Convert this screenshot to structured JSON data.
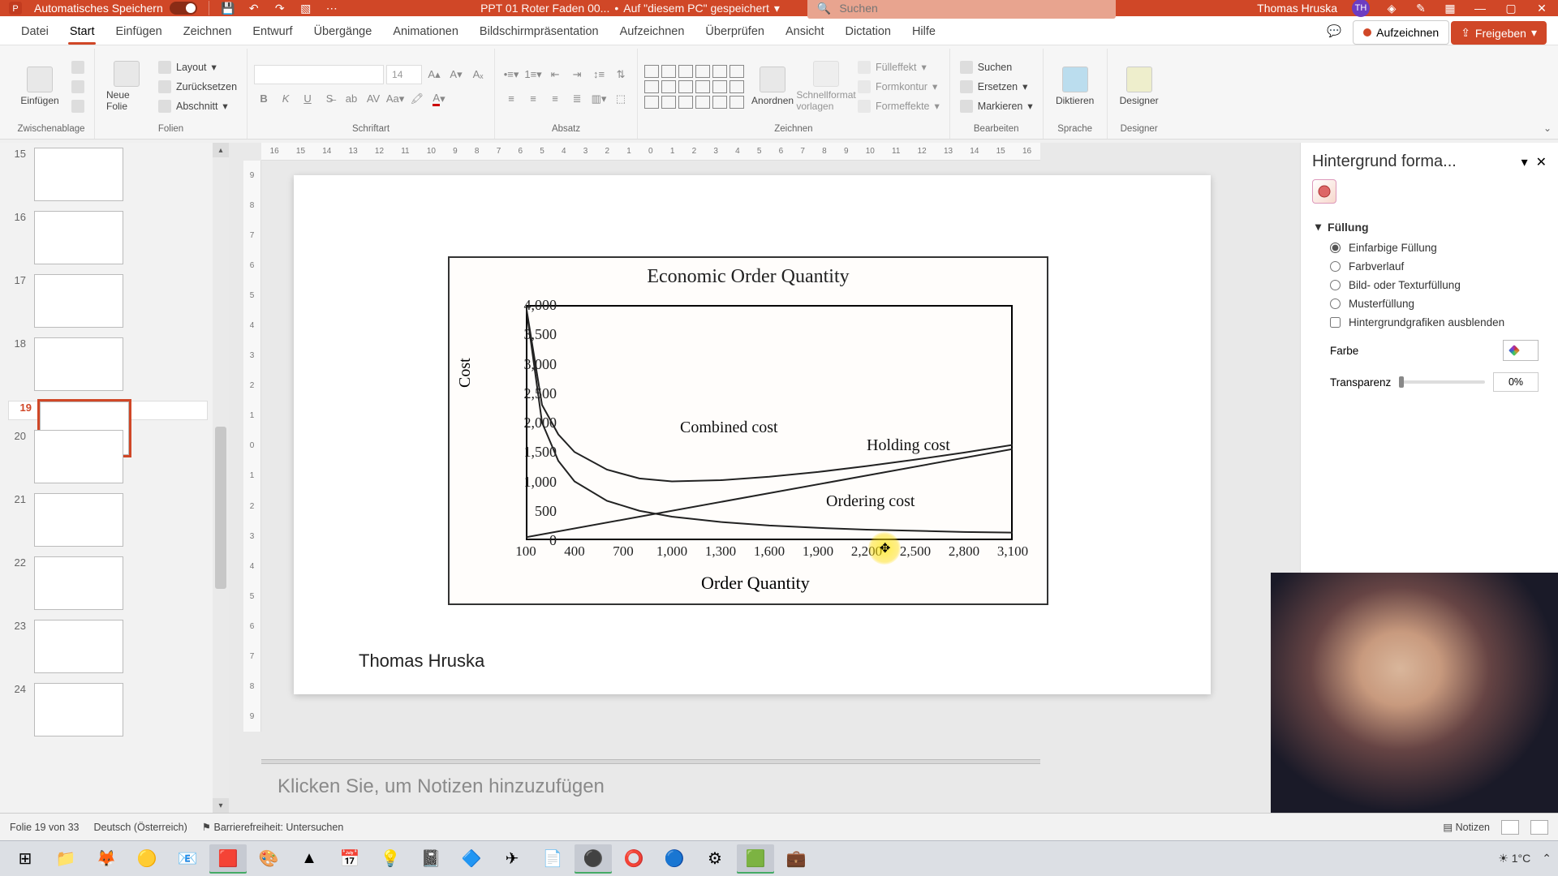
{
  "titlebar": {
    "autosave_label": "Automatisches Speichern",
    "filename": "PPT 01 Roter Faden 00...",
    "saved_location": "Auf \"diesem PC\" gespeichert",
    "search_placeholder": "Suchen",
    "user_name": "Thomas Hruska",
    "user_initials": "TH"
  },
  "tabs": {
    "file": "Datei",
    "start": "Start",
    "insert": "Einfügen",
    "draw": "Zeichnen",
    "design": "Entwurf",
    "transitions": "Übergänge",
    "animations": "Animationen",
    "slideshow": "Bildschirmpräsentation",
    "record": "Aufzeichnen",
    "review": "Überprüfen",
    "view": "Ansicht",
    "dictation": "Dictation",
    "help": "Hilfe",
    "record_btn": "Aufzeichnen",
    "share_btn": "Freigeben"
  },
  "ribbon": {
    "clipboard": {
      "paste": "Einfügen",
      "label": "Zwischenablage"
    },
    "slides": {
      "new": "Neue\nFolie",
      "layout": "Layout",
      "reset": "Zurücksetzen",
      "section": "Abschnitt",
      "label": "Folien"
    },
    "font": {
      "size": "14",
      "label": "Schriftart"
    },
    "paragraph": {
      "label": "Absatz"
    },
    "drawing": {
      "arrange": "Anordnen",
      "quickstyles": "Schnellformat\nvorlagen",
      "fill": "Fülleffekt",
      "outline": "Formkontur",
      "effects": "Formeffekte",
      "label": "Zeichnen"
    },
    "editing": {
      "find": "Suchen",
      "replace": "Ersetzen",
      "select": "Markieren",
      "label": "Bearbeiten"
    },
    "voice": {
      "dictate": "Diktieren",
      "label": "Sprache"
    },
    "designer": {
      "btn": "Designer",
      "label": "Designer"
    }
  },
  "thumbs": {
    "items": [
      {
        "n": "15"
      },
      {
        "n": "16"
      },
      {
        "n": "17"
      },
      {
        "n": "18"
      },
      {
        "n": "19"
      },
      {
        "n": "20"
      },
      {
        "n": "21"
      },
      {
        "n": "22"
      },
      {
        "n": "23"
      },
      {
        "n": "24"
      }
    ],
    "selected": 19
  },
  "ruler_h": [
    "16",
    "15",
    "14",
    "13",
    "12",
    "11",
    "10",
    "9",
    "8",
    "7",
    "6",
    "5",
    "4",
    "3",
    "2",
    "1",
    "0",
    "1",
    "2",
    "3",
    "4",
    "5",
    "6",
    "7",
    "8",
    "9",
    "10",
    "11",
    "12",
    "13",
    "14",
    "15",
    "16"
  ],
  "ruler_v": [
    "9",
    "8",
    "7",
    "6",
    "5",
    "4",
    "3",
    "2",
    "1",
    "0",
    "1",
    "2",
    "3",
    "4",
    "5",
    "6",
    "7",
    "8",
    "9"
  ],
  "slide": {
    "author": "Thomas Hruska"
  },
  "notes_placeholder": "Klicken Sie, um Notizen hinzuzufügen",
  "pane": {
    "title": "Hintergrund forma...",
    "section": "Füllung",
    "opt_solid": "Einfarbige Füllung",
    "opt_gradient": "Farbverlauf",
    "opt_picture": "Bild- oder Texturfüllung",
    "opt_pattern": "Musterfüllung",
    "opt_hidebg": "Hintergrundgrafiken ausblenden",
    "color_label": "Farbe",
    "trans_label": "Transparenz",
    "trans_value": "0%"
  },
  "status": {
    "slide": "Folie 19 von 33",
    "lang": "Deutsch (Österreich)",
    "a11y": "Barrierefreiheit: Untersuchen",
    "notes": "Notizen"
  },
  "tray": {
    "weather": "1°C"
  },
  "chart_data": {
    "type": "line",
    "title": "Economic Order Quantity",
    "xlabel": "Order Quantity",
    "ylabel": "Cost",
    "xlim": [
      100,
      3100
    ],
    "ylim": [
      0,
      4000
    ],
    "x_ticks": [
      "100",
      "400",
      "700",
      "1,000",
      "1,300",
      "1,600",
      "1,900",
      "2,200",
      "2,500",
      "2,800",
      "3,100"
    ],
    "y_ticks": [
      "0",
      "500",
      "1,000",
      "1,500",
      "2,000",
      "2,500",
      "3,000",
      "3,500",
      "4,000"
    ],
    "series": [
      {
        "name": "Combined cost",
        "x": [
          100,
          200,
          300,
          400,
          600,
          800,
          1000,
          1300,
          1600,
          1900,
          2200,
          2500,
          2800,
          3100
        ],
        "y": [
          4000,
          2300,
          1800,
          1500,
          1200,
          1050,
          1000,
          1020,
          1080,
          1160,
          1260,
          1370,
          1490,
          1620
        ]
      },
      {
        "name": "Holding cost",
        "x": [
          100,
          3100
        ],
        "y": [
          50,
          1550
        ]
      },
      {
        "name": "Ordering cost",
        "x": [
          100,
          200,
          300,
          400,
          600,
          800,
          1000,
          1300,
          1600,
          1900,
          2200,
          2500,
          2800,
          3100
        ],
        "y": [
          4000,
          2000,
          1350,
          1000,
          670,
          500,
          400,
          310,
          250,
          210,
          180,
          160,
          140,
          130
        ]
      }
    ],
    "annotations": [
      {
        "text": "Combined cost",
        "x": 1350,
        "y": 1900
      },
      {
        "text": "Holding cost",
        "x": 2500,
        "y": 1600
      },
      {
        "text": "Ordering cost",
        "x": 2250,
        "y": 650
      }
    ]
  }
}
